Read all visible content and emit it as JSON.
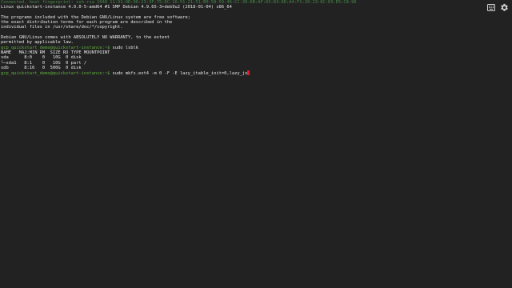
{
  "terminal": {
    "colors": {
      "background": "#222222",
      "text": "#e6e6e6",
      "prompt": "#5fae3e",
      "cursor": "#e01b24",
      "dim": "#4a8a4a"
    },
    "connection_line": "Connected, host fingerprint: ssh-rsa 2048 11:91:0D:06:23:3F:75:DC:16:51:21:51:B0:58:59:46:CC:39:6B:AF:03:83:6D:A4:F1:20:23:6C:63:E5:C8:96",
    "kernel_line": "Linux quickstart-instance 4.9.0-5-amd64 #1 SMP Debian 4.9.65-3+deb9u2 (2018-01-04) x86_64",
    "motd": [
      "The programs included with the Debian GNU/Linux system are free software;",
      "the exact distribution terms for each program are described in the",
      "individual files in /usr/share/doc/*/copyright.",
      "Debian GNU/Linux comes with ABSOLUTELY NO WARRANTY, to the extent",
      "permitted by applicable law."
    ],
    "prompt": "gcp_quickstart_demo@quickstart-instance:~$",
    "command_1": " sudo lsblk",
    "lsblk": [
      "NAME   MAJ:MIN RM  SIZE RO TYPE MOUNTPOINT",
      "sda      8:0    0   10G  0 disk",
      "└─sda1   8:1    0   10G  0 part /",
      "sdb      8:16   0  500G  0 disk"
    ],
    "command_2": " sudo mkfs.ext4 -m 0 -F -E lazy_itable_init=0,lazy_jo"
  },
  "toolbar": {
    "keyboard_icon": "keyboard-icon",
    "settings_icon": "gear-icon"
  }
}
